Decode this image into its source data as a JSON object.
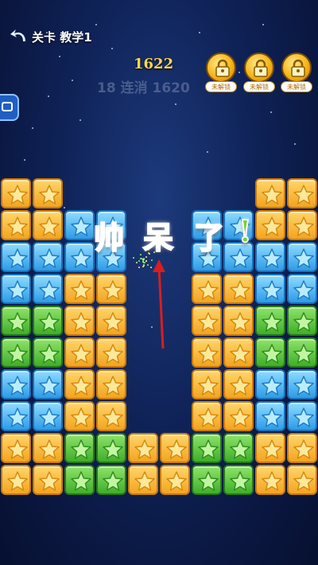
{
  "header": {
    "back_icon": "back-arrow-icon",
    "level_label": "关卡 教学1"
  },
  "score": "1622",
  "combo_text": "18 连消 1620",
  "locked_features": [
    {
      "icon": "padlock-icon",
      "label": "未解锁"
    },
    {
      "icon": "padlock-icon",
      "label": "未解锁"
    },
    {
      "icon": "padlock-icon",
      "label": "未解锁"
    }
  ],
  "side_tab_icon": "side-tab-icon",
  "praise": [
    "帅",
    "呆",
    "了",
    "!"
  ],
  "colors": {
    "yellow_tile": "#f3a41f",
    "blue_tile": "#2d9be6",
    "green_tile": "#3fae2a",
    "background": "#0f2257",
    "score_gold": "#ffd84d",
    "arrow": "#d91e1e",
    "praise_red": "#e8262a",
    "praise_yellow": "#ffd21f",
    "praise_magenta": "#e22fd8",
    "praise_green": "#6fd62a"
  },
  "board": {
    "columns": 10,
    "rows": [
      [
        "Y",
        "Y",
        "",
        "",
        "",
        "",
        "",
        "",
        "Y",
        "Y"
      ],
      [
        "Y",
        "Y",
        "B",
        "B",
        "",
        "",
        "B",
        "B",
        "Y",
        "Y"
      ],
      [
        "B",
        "B",
        "B",
        "B",
        "",
        "",
        "B",
        "B",
        "B",
        "B"
      ],
      [
        "B",
        "B",
        "Y",
        "Y",
        "",
        "",
        "Y",
        "Y",
        "B",
        "B"
      ],
      [
        "G",
        "G",
        "Y",
        "Y",
        "",
        "",
        "Y",
        "Y",
        "G",
        "G"
      ],
      [
        "G",
        "G",
        "Y",
        "Y",
        "",
        "",
        "Y",
        "Y",
        "G",
        "G"
      ],
      [
        "B",
        "B",
        "Y",
        "Y",
        "",
        "",
        "Y",
        "Y",
        "B",
        "B"
      ],
      [
        "B",
        "B",
        "Y",
        "Y",
        "",
        "",
        "Y",
        "Y",
        "B",
        "B"
      ],
      [
        "Y",
        "Y",
        "G",
        "G",
        "Y",
        "Y",
        "G",
        "G",
        "Y",
        "Y"
      ],
      [
        "Y",
        "Y",
        "G",
        "G",
        "Y",
        "Y",
        "G",
        "G",
        "Y",
        "Y"
      ]
    ]
  }
}
